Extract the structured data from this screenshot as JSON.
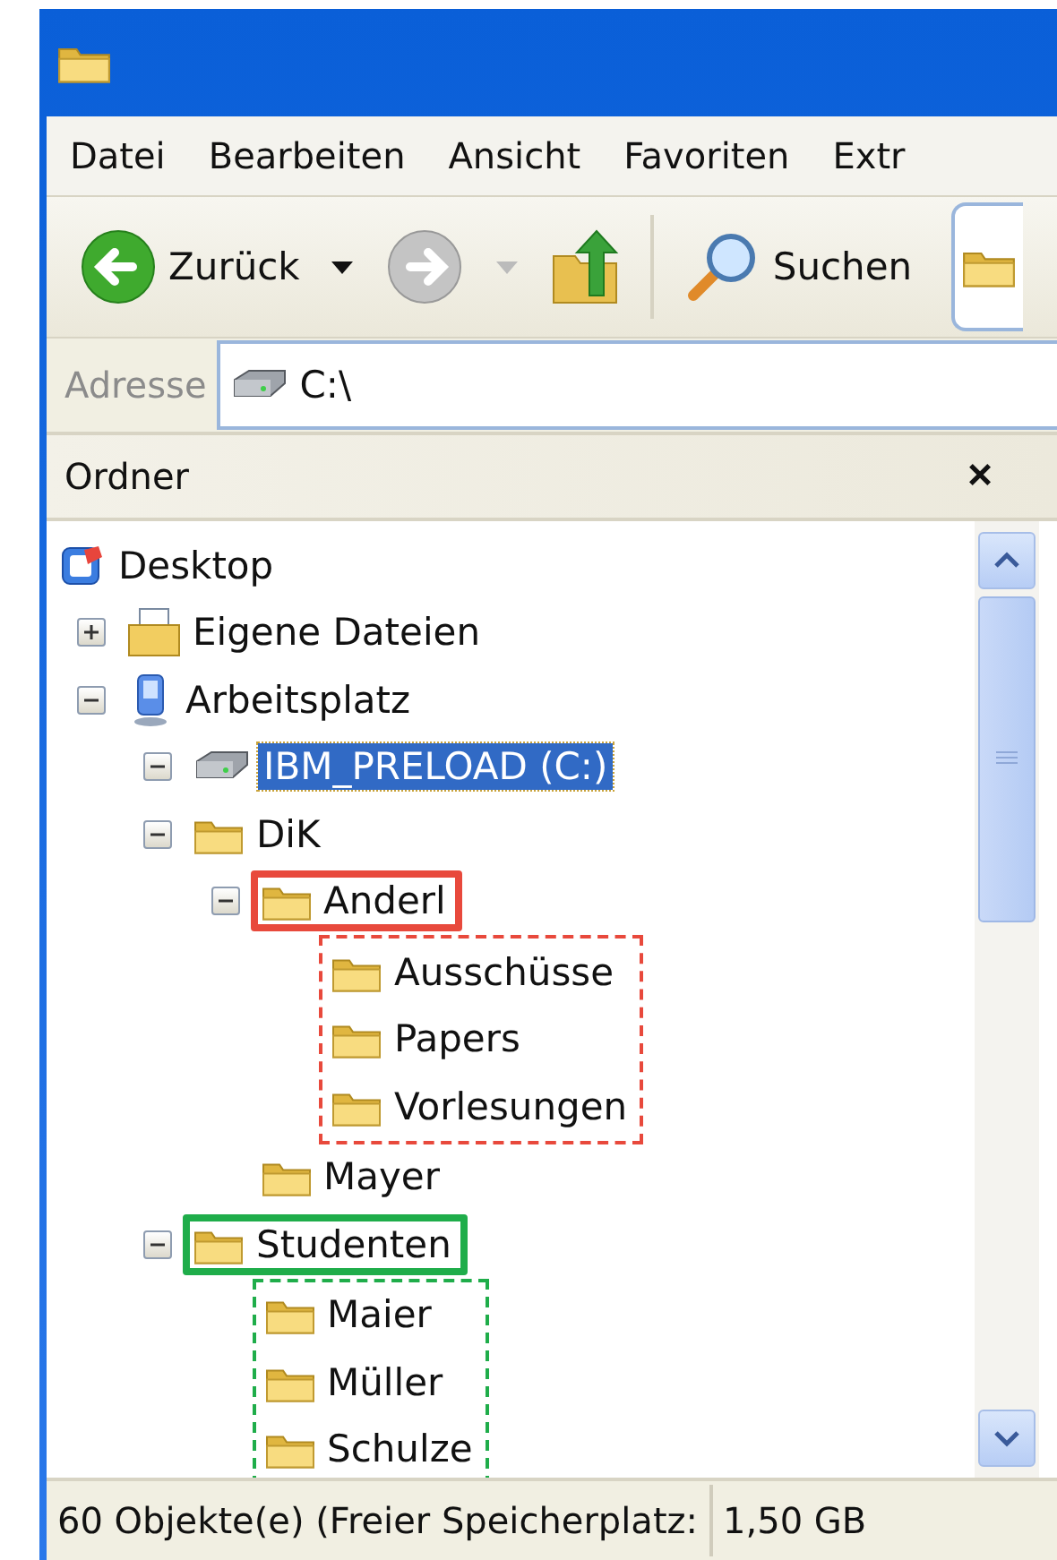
{
  "menu": [
    {
      "label": "Datei"
    },
    {
      "label": "Bearbeiten"
    },
    {
      "label": "Ansicht"
    },
    {
      "label": "Favoriten"
    },
    {
      "label": "Extr"
    }
  ],
  "toolbar": {
    "back": {
      "label": "Zurück",
      "disabled": false
    },
    "forward": {
      "disabled": true
    },
    "search": {
      "label": "Suchen"
    }
  },
  "address": {
    "label": "Adresse",
    "value": "C:\\"
  },
  "folders_pane": {
    "title": "Ordner",
    "close": "×",
    "tree": [
      {
        "label": "Desktop",
        "kind": "desktop",
        "selected": false,
        "children": [
          {
            "label": "Eigene Dateien",
            "kind": "documents",
            "expanded": false,
            "selected": false
          },
          {
            "label": "Arbeitsplatz",
            "kind": "computer",
            "expanded": true,
            "selected": false,
            "children": [
              {
                "label": "IBM_PRELOAD (C:)",
                "kind": "drive",
                "expanded": true,
                "selected": true
              },
              {
                "label": "DiK",
                "kind": "folder",
                "expanded": true,
                "selected": false,
                "children": [
                  {
                    "label": "Anderl",
                    "kind": "folder",
                    "expanded": true,
                    "selected": false,
                    "color": "#e8493c",
                    "children": [
                      {
                        "label": "Ausschüsse",
                        "kind": "folder",
                        "selected": false
                      },
                      {
                        "label": "Papers",
                        "kind": "folder",
                        "selected": false
                      },
                      {
                        "label": "Vorlesungen",
                        "kind": "folder",
                        "selected": false
                      }
                    ]
                  },
                  {
                    "label": "Mayer",
                    "kind": "folder",
                    "selected": false
                  }
                ]
              },
              {
                "label": "Studenten",
                "kind": "folder",
                "expanded": true,
                "selected": false,
                "color": "#1fad4a",
                "children": [
                  {
                    "label": "Maier",
                    "kind": "folder",
                    "selected": false
                  },
                  {
                    "label": "Müller",
                    "kind": "folder",
                    "selected": false
                  },
                  {
                    "label": "Schulze",
                    "kind": "folder",
                    "selected": false
                  }
                ]
              }
            ]
          }
        ]
      }
    ]
  },
  "status_bar": [
    {
      "text": "60 Objekte(e) (Freier Speicherplatz:"
    },
    {
      "text": "1,50 GB"
    }
  ]
}
